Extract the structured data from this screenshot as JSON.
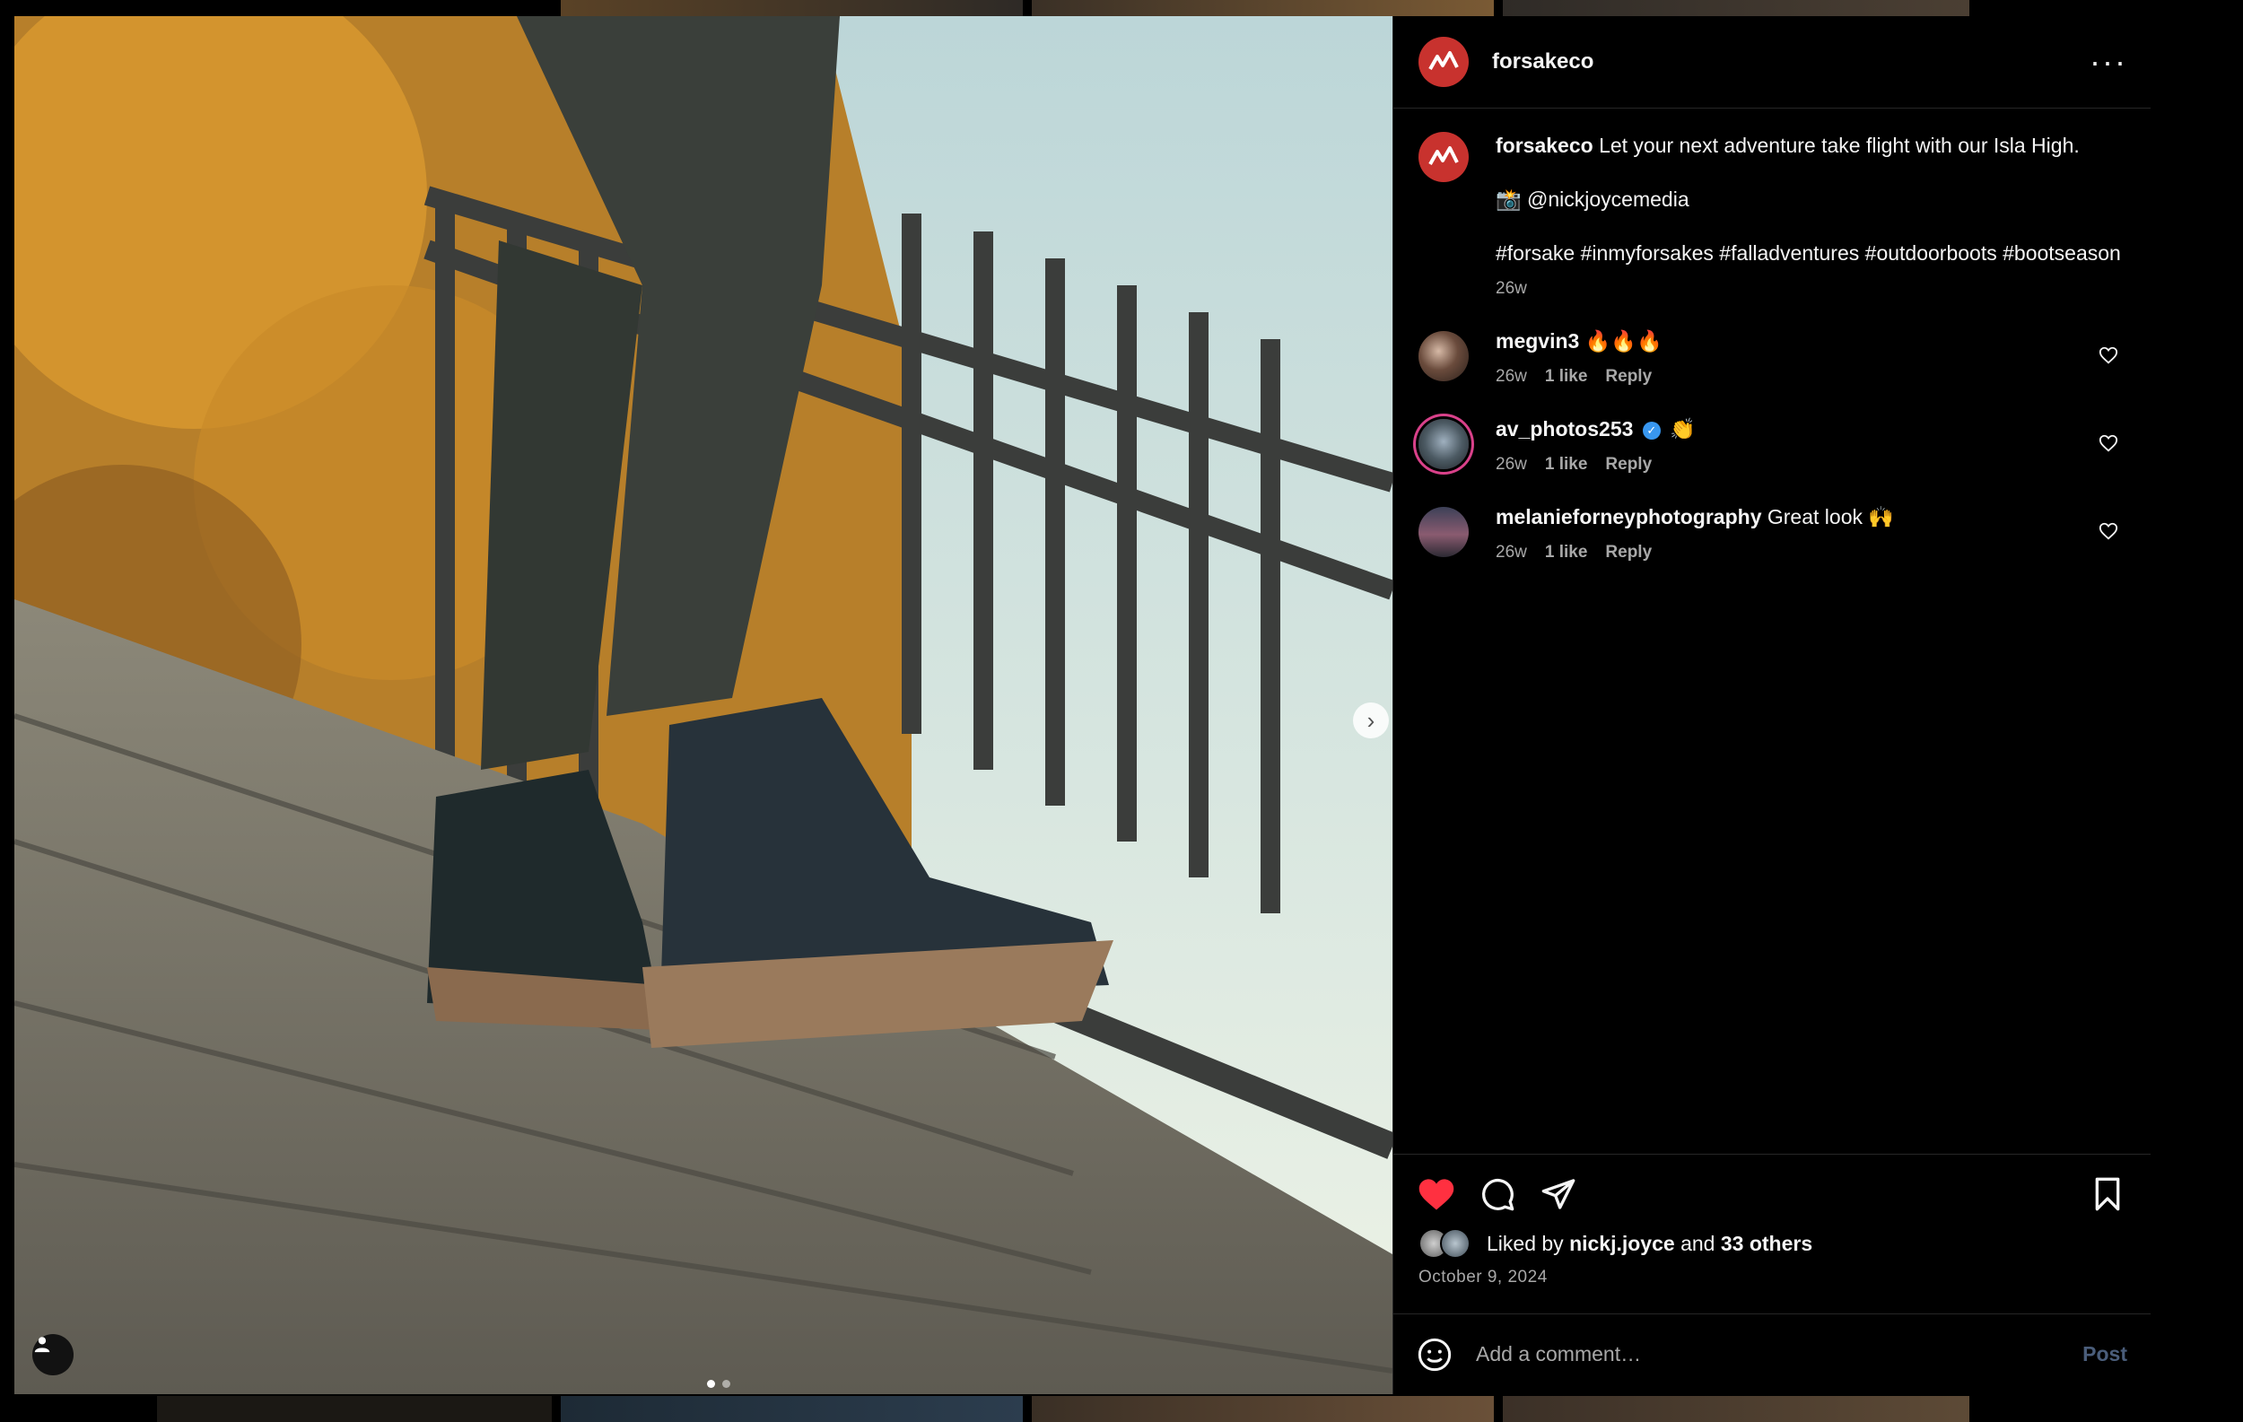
{
  "post": {
    "username": "forsakeco",
    "caption": {
      "text": "Let your next adventure take flight with our Isla High.",
      "credit": "📸 @nickjoycemedia",
      "hashtags": "#forsake #inmyforsakes #falladventures #outdoorboots #bootseason",
      "age": "26w"
    },
    "comments": [
      {
        "username": "megvin3",
        "text": "🔥🔥🔥",
        "age": "26w",
        "likes": "1 like",
        "reply": "Reply",
        "verified": false
      },
      {
        "username": "av_photos253",
        "text": "👏",
        "age": "26w",
        "likes": "1 like",
        "reply": "Reply",
        "verified": true
      },
      {
        "username": "melanieforneyphotography",
        "text": "Great look 🙌",
        "age": "26w",
        "likes": "1 like",
        "reply": "Reply",
        "verified": false
      }
    ],
    "liked_by_prefix": "Liked by",
    "liked_by_user": "nickj.joyce",
    "liked_by_joiner": "and",
    "liked_by_others": "33 others",
    "date": "October 9, 2024",
    "carousel": {
      "total": 2,
      "current": 1
    }
  },
  "comment_box": {
    "placeholder": "Add a comment…",
    "post_label": "Post"
  },
  "icons": {
    "like": "heart-icon-filled",
    "comment": "comment-icon",
    "share": "share-icon",
    "save": "bookmark-icon",
    "more": "more-horizontal-icon",
    "emoji": "emoji-icon",
    "next": "chevron-right-icon",
    "tagged_user": "user-icon"
  },
  "colors": {
    "like_red": "#ff3040",
    "brand_red": "#c8322e",
    "verified_blue": "#3897f0",
    "muted": "#a8a8a8",
    "post_button": "#4a5d7a"
  }
}
